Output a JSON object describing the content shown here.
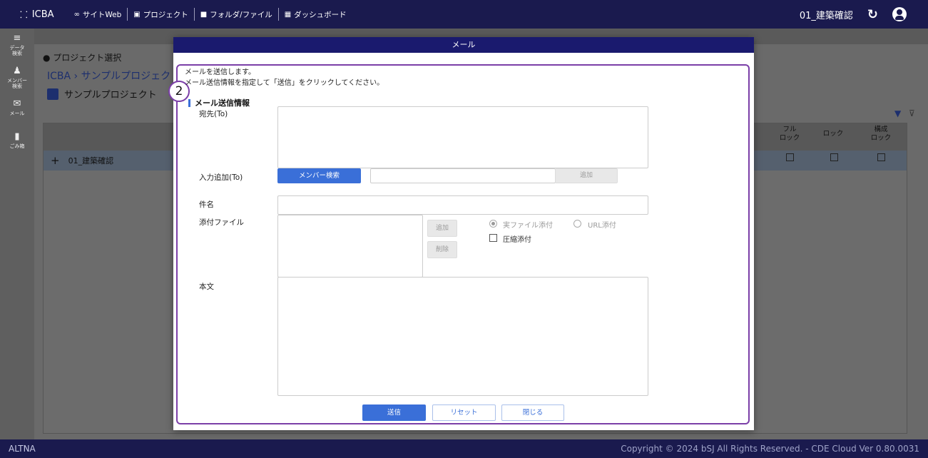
{
  "topbar": {
    "brand": "ICBA",
    "nav": [
      {
        "icon": "link-icon",
        "label": "サイトWeb"
      },
      {
        "icon": "archive-icon",
        "label": "プロジェクト"
      },
      {
        "icon": "folder-icon",
        "label": "フォルダ/ファイル"
      },
      {
        "icon": "dashboard-icon",
        "label": "ダッシュボード"
      }
    ],
    "project": "01_建築確認"
  },
  "rail": [
    {
      "icon": "data-search-icon",
      "label": "データ\n検索"
    },
    {
      "icon": "member-search-icon",
      "label": "メンバー\n検索"
    },
    {
      "icon": "mail-icon",
      "label": "メール"
    },
    {
      "icon": "trash-icon",
      "label": "ごみ箱"
    }
  ],
  "page": {
    "title": "● プロジェクト選択",
    "breadcrumb": "ICBA  ›  サンプルプロジェクト",
    "project_name": "サンプルプロジェクト",
    "row_label": "01_建築確認",
    "col_full_lock": "フル\nロック",
    "col_lock": "ロック",
    "col_config_lock": "構成\nロック"
  },
  "modal": {
    "title": "メール",
    "badge": "2",
    "intro_line1": "メールを送信します。",
    "intro_line2": "メール送信情報を指定して「送信」をクリックしてください。",
    "section": "メール送信情報",
    "label_to": "宛先(To)",
    "label_add_to": "入力追加(To)",
    "member_search": "メンバー検索",
    "add_to": "追加",
    "label_subject": "件名",
    "label_attach": "添付ファイル",
    "attach_add": "追加",
    "attach_delete": "削除",
    "opt_real_file": "実ファイル添付",
    "opt_url": "URL添付",
    "compress": "圧縮添付",
    "label_body": "本文",
    "send": "送信",
    "reset": "リセット",
    "close": "閉じる"
  },
  "footer": {
    "left": "ALTNA",
    "right": "Copyright © 2024 bSJ All Rights Reserved. - CDE Cloud Ver 0.80.0031"
  }
}
